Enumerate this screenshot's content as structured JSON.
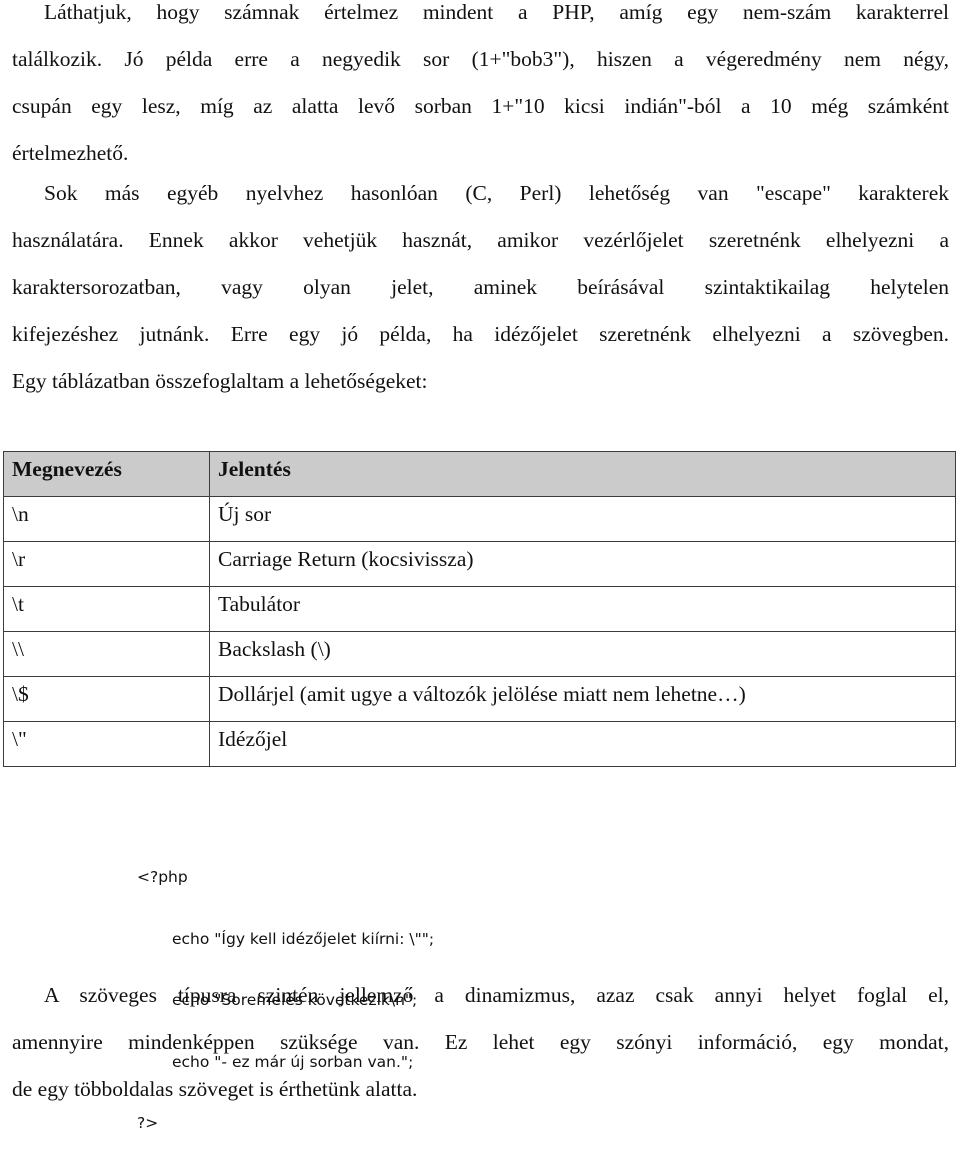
{
  "paragraph1": {
    "lines": [
      "Láthatjuk, hogy számnak értelmez mindent a PHP, amíg egy nem-szám karakterrel",
      "találkozik. Jó példa erre a negyedik sor (1+\"bob3\"), hiszen a végeredmény nem négy,",
      "csupán egy lesz, míg az alatta levő sorban 1+\"10 kicsi indián\"-ból a 10 még számként",
      "értelmezhető."
    ]
  },
  "paragraph2": {
    "lines": [
      "Sok más egyéb nyelvhez hasonlóan (C, Perl) lehetőség van \"escape\" karakterek",
      "használatára. Ennek akkor vehetjük hasznát, amikor vezérlőjelet szeretnénk elhelyezni a",
      "karaktersorozatban, vagy olyan jelet, aminek beírásával szintaktikailag helytelen",
      "kifejezéshez jutnánk. Erre egy jó példa, ha idézőjelet szeretnénk elhelyezni a szövegben.",
      "Egy táblázatban összefoglaltam a lehetőségeket:"
    ]
  },
  "table": {
    "headers": [
      "Megnevezés",
      "Jelentés"
    ],
    "rows": [
      [
        "\\n",
        "Új sor"
      ],
      [
        "\\r",
        "Carriage Return (kocsivissza)"
      ],
      [
        "\\t",
        "Tabulátor"
      ],
      [
        "\\\\",
        "Backslash (\\)"
      ],
      [
        "\\$",
        "Dollárjel (amit ugye a változók jelölése miatt nem lehetne…)"
      ],
      [
        "\\\"",
        "Idézőjel"
      ]
    ]
  },
  "code": {
    "open_tag": "<?php",
    "lines": [
      "echo \"Így kell idézőjelet kiírni: \\\"\";",
      "echo \"Soremelés következik\\n\";",
      "echo \"- ez már új sorban van.\";"
    ],
    "close_tag": "?>"
  },
  "paragraph3": {
    "lines": [
      "A szöveges típusra szintén jellemző a dinamizmus, azaz csak annyi helyet foglal el,",
      "amennyire mindenképpen szüksége van. Ez lehet egy szónyi információ, egy mondat,",
      "de egy többoldalas szöveget is érthetünk alatta."
    ]
  }
}
